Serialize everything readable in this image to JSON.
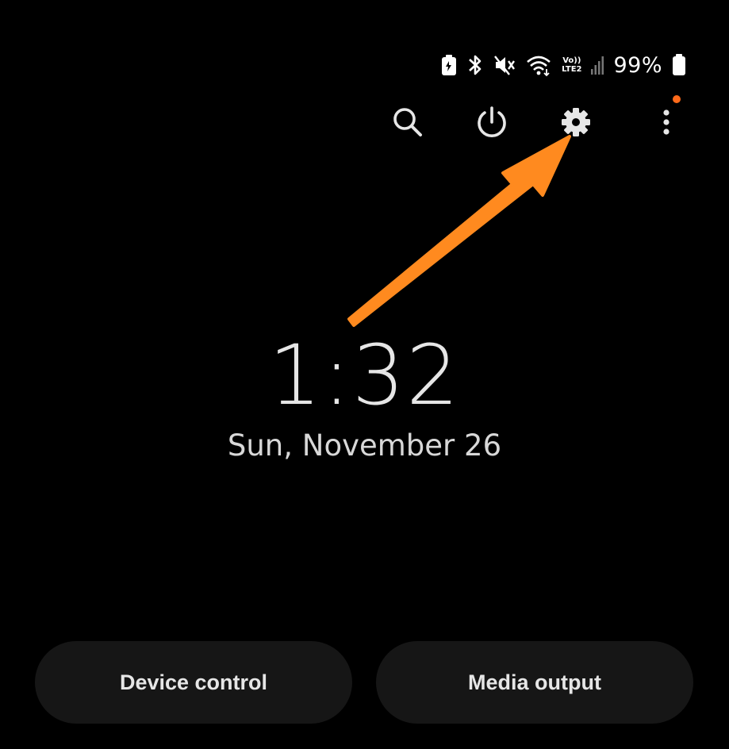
{
  "status_bar": {
    "battery_percent": "99%",
    "network": {
      "top": "Vo))",
      "bottom": "LTE2"
    },
    "icons": [
      "battery-saver-icon",
      "bluetooth-icon",
      "mute-icon",
      "wifi-icon",
      "volte-icon",
      "signal-icon",
      "battery-icon"
    ]
  },
  "toolbar": {
    "icons": [
      "search-icon",
      "power-icon",
      "settings-icon",
      "more-options-icon"
    ],
    "notification_dot_color": "#ff6a1a"
  },
  "clock": {
    "time": "1:32",
    "date": "Sun, November 26"
  },
  "buttons": {
    "device_control": "Device control",
    "media_output": "Media output"
  },
  "annotation": {
    "arrow_color": "#ff8a1f",
    "target": "settings-icon"
  },
  "colors": {
    "background": "#000000",
    "text": "#e6e6e6",
    "pill_background": "#161616"
  }
}
